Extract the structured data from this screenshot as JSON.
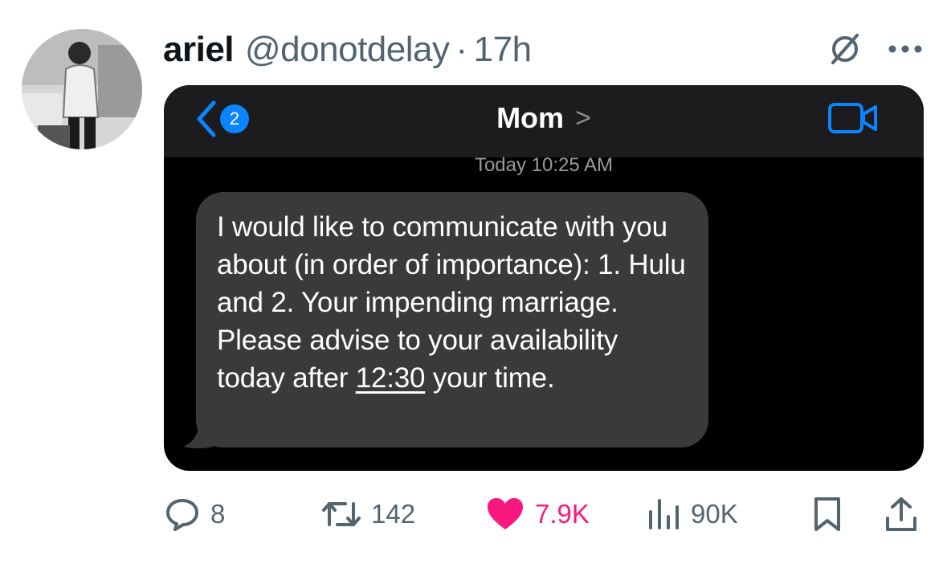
{
  "tweet": {
    "name": "ariel",
    "handle": "@donotdelay",
    "dot": "·",
    "time": "17h"
  },
  "screenshot": {
    "back_badge": "2",
    "contact": "Mom",
    "contact_chevron": ">",
    "timestamp": "Today 10:25 AM",
    "message_before": "I would like to communicate with you about  (in order of importance): 1. Hulu and 2. Your impending marriage. Please advise to your availability today after ",
    "message_link": "12:30",
    "message_after": " your time."
  },
  "actions": {
    "replies": "8",
    "retweets": "142",
    "likes": "7.9K",
    "views": "90K"
  },
  "colors": {
    "like": "#f91880",
    "imessage_blue": "#0a84ff",
    "muted": "#536471"
  },
  "icons": [
    "avatar",
    "grok-icon",
    "more-icon",
    "back-chevron-icon",
    "video-call-icon",
    "reply-icon",
    "retweet-icon",
    "heart-icon",
    "views-icon",
    "bookmark-icon",
    "share-icon"
  ]
}
